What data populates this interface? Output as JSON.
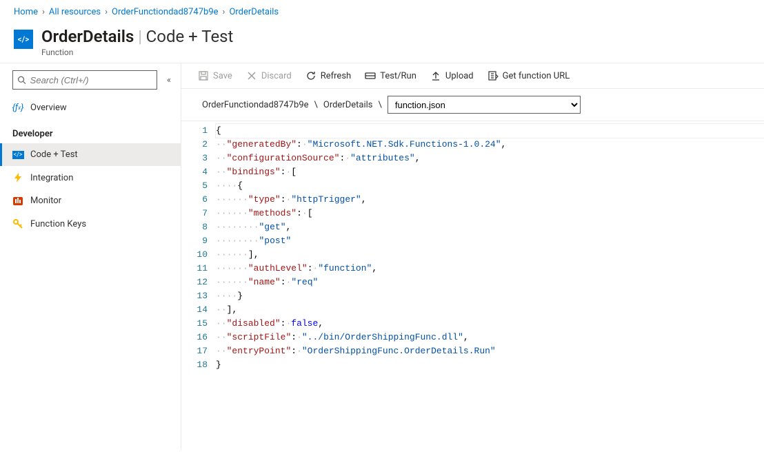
{
  "breadcrumb": {
    "home": "Home",
    "all_resources": "All resources",
    "function_app": "OrderFunctiondad8747b9e",
    "function": "OrderDetails"
  },
  "header": {
    "title": "OrderDetails",
    "section": "Code + Test",
    "subtitle": "Function",
    "badge_glyph": "</>"
  },
  "sidebar": {
    "search_placeholder": "Search (Ctrl+/)",
    "overview_label": "Overview",
    "developer_label": "Developer",
    "items": [
      {
        "label": "Code + Test"
      },
      {
        "label": "Integration"
      },
      {
        "label": "Monitor"
      },
      {
        "label": "Function Keys"
      }
    ]
  },
  "toolbar": {
    "save": "Save",
    "discard": "Discard",
    "refresh": "Refresh",
    "testrun": "Test/Run",
    "upload": "Upload",
    "get_url": "Get function URL"
  },
  "pathbar": {
    "seg1": "OrderFunctiondad8747b9e",
    "seg2": "OrderDetails",
    "file": "function.json"
  },
  "code": {
    "lines": [
      {
        "n": 1,
        "raw": "{"
      },
      {
        "n": 2,
        "raw": "  \"generatedBy\": \"Microsoft.NET.Sdk.Functions-1.0.24\","
      },
      {
        "n": 3,
        "raw": "  \"configurationSource\": \"attributes\","
      },
      {
        "n": 4,
        "raw": "  \"bindings\": ["
      },
      {
        "n": 5,
        "raw": "    {"
      },
      {
        "n": 6,
        "raw": "      \"type\": \"httpTrigger\","
      },
      {
        "n": 7,
        "raw": "      \"methods\": ["
      },
      {
        "n": 8,
        "raw": "        \"get\","
      },
      {
        "n": 9,
        "raw": "        \"post\""
      },
      {
        "n": 10,
        "raw": "      ],"
      },
      {
        "n": 11,
        "raw": "      \"authLevel\": \"function\","
      },
      {
        "n": 12,
        "raw": "      \"name\": \"req\""
      },
      {
        "n": 13,
        "raw": "    }"
      },
      {
        "n": 14,
        "raw": "  ],"
      },
      {
        "n": 15,
        "raw": "  \"disabled\": false,"
      },
      {
        "n": 16,
        "raw": "  \"scriptFile\": \"../bin/OrderShippingFunc.dll\","
      },
      {
        "n": 17,
        "raw": "  \"entryPoint\": \"OrderShippingFunc.OrderDetails.Run\""
      },
      {
        "n": 18,
        "raw": "}"
      }
    ]
  }
}
